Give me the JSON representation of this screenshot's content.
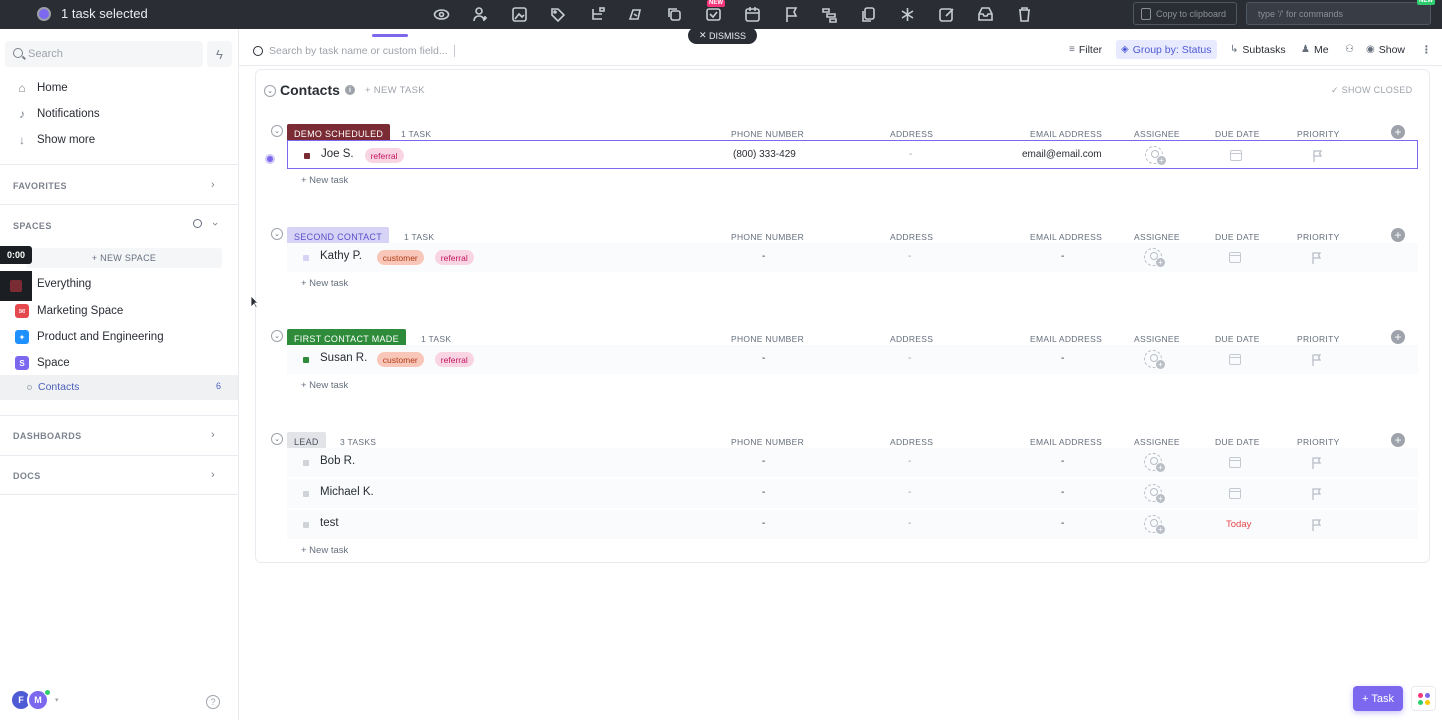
{
  "topbar": {
    "selection_text": "1 task selected",
    "copy_label": "Copy to clipboard",
    "command_placeholder": "type '/' for commands",
    "new_badge": "NEW",
    "dismiss_label": "DISMISS",
    "icons": [
      "eye-icon",
      "assign-user-icon",
      "image-icon",
      "tag-icon",
      "subtasks-icon",
      "move-icon",
      "duplicate-icon",
      "status-icon",
      "calendar-icon",
      "flag-icon",
      "dependencies-icon",
      "copy-icon",
      "merge-icon",
      "edit-icon",
      "archive-icon",
      "trash-icon"
    ]
  },
  "sidebar": {
    "search_placeholder": "Search",
    "nav": [
      {
        "label": "Home",
        "icon": "home-icon"
      },
      {
        "label": "Notifications",
        "icon": "bell-icon"
      },
      {
        "label": "Show more",
        "icon": "arrow-down-icon"
      }
    ],
    "favorites_label": "FAVORITES",
    "spaces_label": "SPACES",
    "new_space_label": "+ NEW SPACE",
    "timer": "0:00",
    "spaces": [
      {
        "label": "Everything",
        "color": "#7a2b33",
        "letter": ""
      },
      {
        "label": "Marketing Space",
        "color": "#e5484d",
        "letter": "✉"
      },
      {
        "label": "Product and Engineering",
        "color": "#1e90ff",
        "letter": "✦"
      },
      {
        "label": "Space",
        "color": "#7b68ee",
        "letter": "S"
      }
    ],
    "active_list": {
      "label": "Contacts",
      "count": "6"
    },
    "dashboards_label": "DASHBOARDS",
    "docs_label": "DOCS",
    "avatars": [
      {
        "letter": "F",
        "color": "#4f5bd5"
      },
      {
        "letter": "M",
        "color": "#7b68ee"
      }
    ]
  },
  "filterbar": {
    "search_placeholder": "Search by task name or custom field...",
    "filter_label": "Filter",
    "group_by_label": "Group by: Status",
    "subtasks_label": "Subtasks",
    "me_label": "Me",
    "show_label": "Show"
  },
  "list": {
    "title": "Contacts",
    "new_task_label": "+ NEW TASK",
    "show_closed_label": "SHOW CLOSED",
    "columns": {
      "phone": "PHONE NUMBER",
      "address": "ADDRESS",
      "email": "EMAIL ADDRESS",
      "assignee": "ASSIGNEE",
      "due": "DUE DATE",
      "priority": "PRIORITY"
    },
    "new_task_row_label": "+ New task",
    "groups": [
      {
        "status": "DEMO SCHEDULED",
        "count": "1 TASK",
        "bg": "#7a2b33",
        "fg": "#ffffff",
        "square": "#7a2b33",
        "tasks": [
          {
            "name": "Joe S.",
            "tags": [
              "referral"
            ],
            "phone": "(800) 333-429",
            "address": "-",
            "email": "email@email.com",
            "due": ""
          }
        ]
      },
      {
        "status": "SECOND CONTACT",
        "count": "1 TASK",
        "bg": "#d7d3f7",
        "fg": "#5b4fc8",
        "square": "#d7d3f7",
        "tasks": [
          {
            "name": "Kathy P.",
            "tags": [
              "customer",
              "referral"
            ],
            "phone": "-",
            "address": "-",
            "email": "-",
            "due": ""
          }
        ]
      },
      {
        "status": "FIRST CONTACT MADE",
        "count": "1 TASK",
        "bg": "#2e8b3a",
        "fg": "#ffffff",
        "square": "#2e8b3a",
        "tasks": [
          {
            "name": "Susan R.",
            "tags": [
              "customer",
              "referral"
            ],
            "phone": "-",
            "address": "-",
            "email": "-",
            "due": ""
          }
        ]
      },
      {
        "status": "LEAD",
        "count": "3 TASKS",
        "bg": "#e2e4e8",
        "fg": "#4b5360",
        "square": "#d0d3d8",
        "tasks": [
          {
            "name": "Bob R.",
            "tags": [],
            "phone": "-",
            "address": "-",
            "email": "-",
            "due": ""
          },
          {
            "name": "Michael K.",
            "tags": [],
            "phone": "-",
            "address": "-",
            "email": "-",
            "due": ""
          },
          {
            "name": "test",
            "tags": [],
            "phone": "-",
            "address": "-",
            "email": "-",
            "due": "Today"
          }
        ]
      }
    ]
  },
  "fab": {
    "task_label": "Task"
  }
}
